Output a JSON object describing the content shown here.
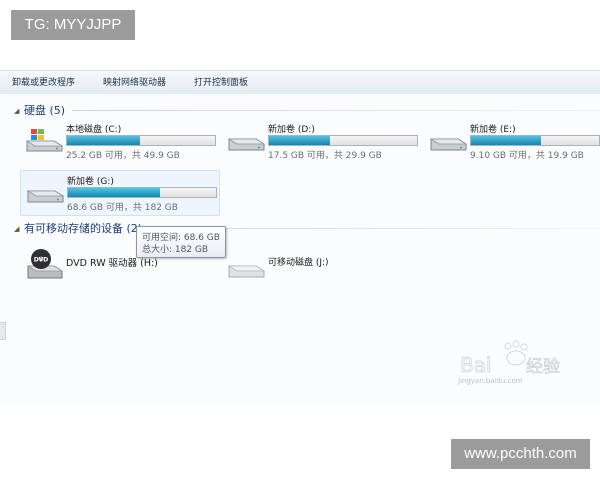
{
  "badges": {
    "top_left": "TG: MYYJJPP",
    "bottom_right": "www.pcchth.com"
  },
  "toolbar": {
    "items": [
      "卸载或更改程序",
      "映射网络驱动器",
      "打开控制面板"
    ]
  },
  "sections": {
    "hard_disks": {
      "title": "硬盘 (5)"
    },
    "removable": {
      "title": "有可移动存储的设备 (2)"
    }
  },
  "drives": [
    {
      "name": "本地磁盘 (C:)",
      "info": "25.2 GB 可用，共 49.9 GB",
      "used_fraction": 0.495,
      "icon": "windows-drive-icon"
    },
    {
      "name": "新加卷 (D:)",
      "info": "17.5 GB 可用，共 29.9 GB",
      "used_fraction": 0.415,
      "icon": "hard-drive-icon"
    },
    {
      "name": "新加卷 (E:)",
      "info": "9.10 GB 可用，共 19.9 GB",
      "used_fraction": 0.543,
      "icon": "hard-drive-icon"
    },
    {
      "name": "新加卷 (G:)",
      "info": "68.6 GB 可用，共 182 GB",
      "used_fraction": 0.623,
      "icon": "hard-drive-icon"
    }
  ],
  "removable_devices": [
    {
      "name": "DVD RW 驱动器 (H:)",
      "icon": "dvd-drive-icon"
    },
    {
      "name": "可移动磁盘 (J:)",
      "icon": "removable-disk-icon"
    }
  ],
  "tooltip": {
    "free": "可用空间: 68.6 GB",
    "total": "总大小: 182 GB"
  },
  "watermark": {
    "text": "jingyan.baidu.com"
  },
  "colors": {
    "bar_fill": "#1983b3",
    "section_header": "#1e3d78"
  }
}
